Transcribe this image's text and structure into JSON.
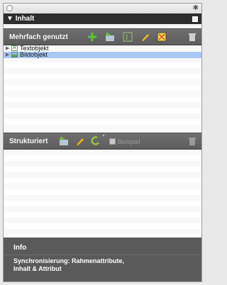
{
  "panel": {
    "title": "Inhalt"
  },
  "section1": {
    "label": "Mehrfach genutzt",
    "items": [
      {
        "label": "Textobjekt",
        "icon": "text-object-icon",
        "selected": false
      },
      {
        "label": "Bildobjekt",
        "icon": "image-object-icon",
        "selected": true
      }
    ]
  },
  "section2": {
    "label": "Strukturiert",
    "checkbox_label": "Beispiel"
  },
  "info": {
    "title": "Info",
    "text": "Synchronisierung: Rahmenattribute,\nInhalt & Attribut"
  },
  "colors": {
    "selection": "#a9c8f1",
    "toolbar": "#666666",
    "header": "#2d2d2d",
    "add": "#5cc23a",
    "pencil": "#f3b418"
  }
}
